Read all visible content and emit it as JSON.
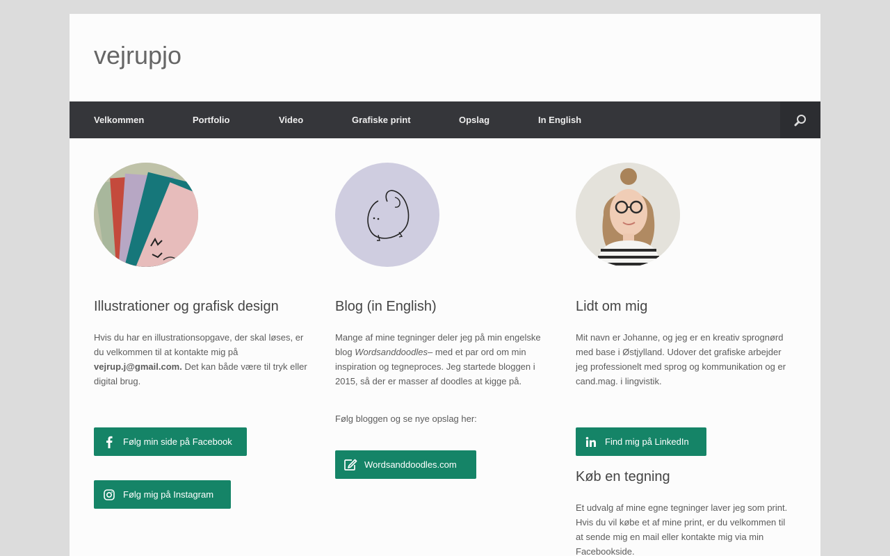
{
  "site": {
    "title": "vejrupjo"
  },
  "nav": {
    "items": [
      "Velkommen",
      "Portfolio",
      "Video",
      "Grafiske print",
      "Opslag",
      "In English"
    ],
    "search_icon": "search-icon"
  },
  "columns": {
    "col1": {
      "image": "illustration-prints-photo",
      "heading": "Illustrationer og grafisk design",
      "text_a": "Hvis du har en illustrationsopgave, der skal løses, er du velkommen til at kontakte mig på ",
      "email": "vejrup.j@gmail.com.",
      "text_b": " Det kan både være til tryk eller digital brug.",
      "btn_facebook": "Følg min side på Facebook",
      "btn_instagram": "Følg mig på Instagram"
    },
    "col2": {
      "image": "doodle-avatar",
      "heading": "Blog (in English)",
      "text_a": "Mange af mine tegninger deler jeg på min engelske blog ",
      "blog_name": "Wordsanddoodles",
      "text_b": "– med et par ord om min inspiration og tegneproces. Jeg startede bloggen i 2015, så der er masser af doodles at kigge på.",
      "text_c": "Følg bloggen og se nye opslag her:",
      "btn_blog": "Wordsanddoodles.com"
    },
    "col3": {
      "image": "portrait-photo",
      "heading": "Lidt om mig",
      "text": "Mit navn er Johanne, og jeg er en kreativ sprognørd med base i Østjylland. Udover det grafiske arbejder jeg professionelt med sprog og kommunikation og er cand.mag. i lingvistik.",
      "btn_linkedin": "Find mig på LinkedIn",
      "heading2": "Køb en tegning",
      "text2": "Et udvalg af mine egne tegninger laver jeg som print. Hvis du vil købe et af mine print, er du velkommen til at sende mig en mail eller kontakte mig via min Facebookside."
    }
  },
  "colors": {
    "nav_bg": "#35363a",
    "button": "#158467",
    "page_bg": "#dcdcdc"
  }
}
